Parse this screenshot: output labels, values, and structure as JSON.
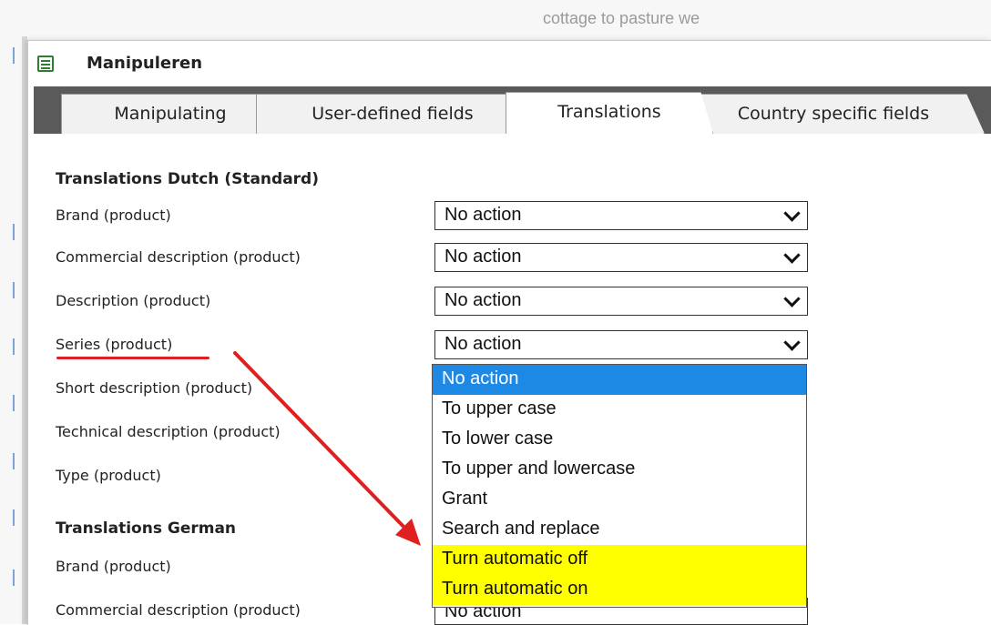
{
  "background": {
    "text": "cottage to pasture we"
  },
  "dialog": {
    "title": "Manipuleren",
    "tabs": [
      {
        "label": "Manipulating",
        "active": false
      },
      {
        "label": "User-defined fields",
        "active": false
      },
      {
        "label": "Translations",
        "active": true
      },
      {
        "label": "Country specific fields",
        "active": false
      }
    ],
    "sections": [
      {
        "title": "Translations Dutch (Standard)",
        "fields": [
          {
            "label": "Brand (product)",
            "value": "No action"
          },
          {
            "label": "Commercial description (product)",
            "value": "No action"
          },
          {
            "label": "Description (product)",
            "value": "No action"
          },
          {
            "label": "Series (product)",
            "value": "No action"
          },
          {
            "label": "Short description (product)"
          },
          {
            "label": "Technical description (product)"
          },
          {
            "label": "Type (product)"
          }
        ]
      },
      {
        "title": "Translations German",
        "fields": [
          {
            "label": "Brand (product)"
          },
          {
            "label": "Commercial description (product)",
            "value": "No action"
          }
        ]
      }
    ],
    "dropdown_options": [
      "No action",
      "To upper case",
      "To lower case",
      "To upper and lowercase",
      "Grant",
      "Search and replace",
      "Turn automatic off",
      "Turn automatic on"
    ]
  },
  "colors": {
    "selected_option": "#1e88e5",
    "highlight": "#ffff00",
    "annotation": "#e02020"
  }
}
